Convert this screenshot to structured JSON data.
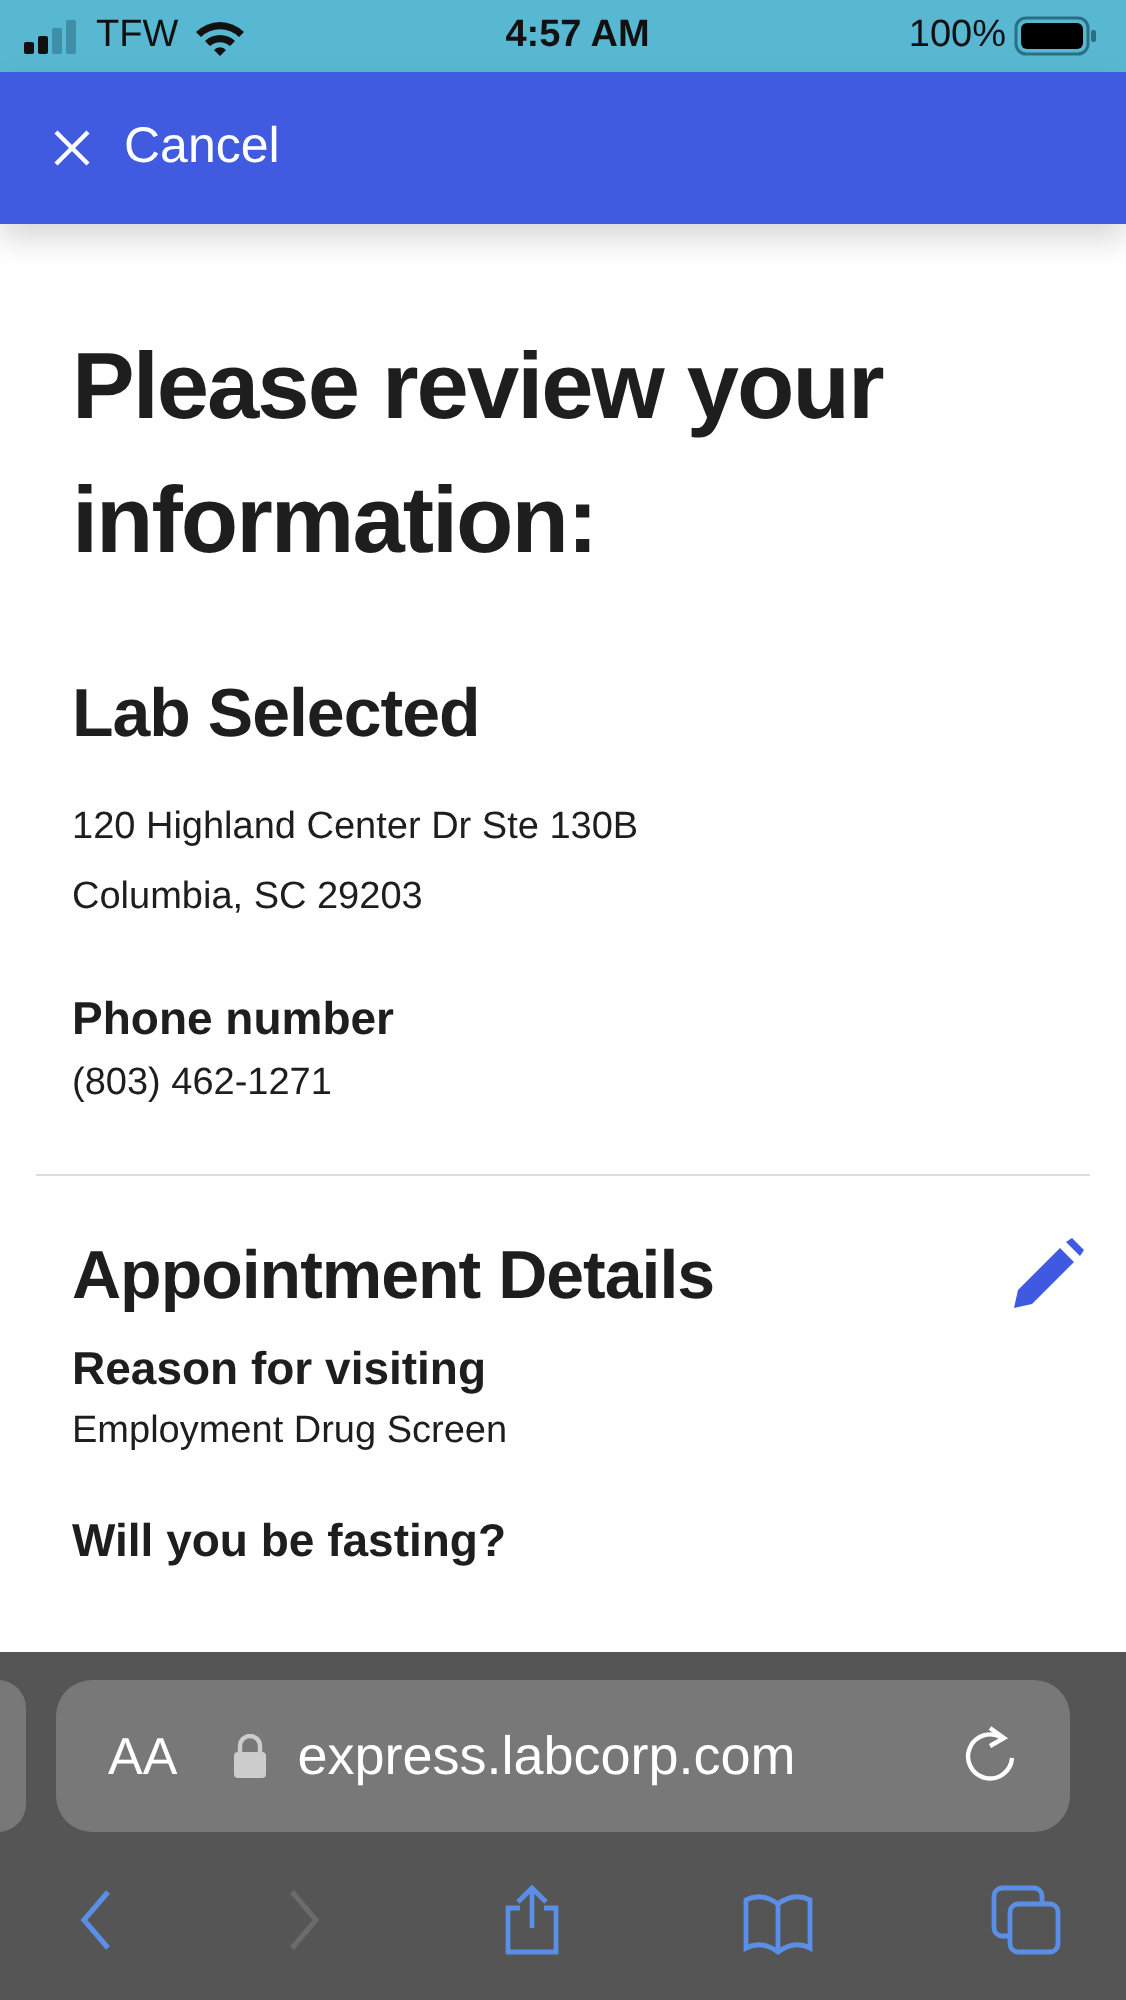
{
  "status_bar": {
    "carrier": "TFW",
    "time": "4:57 AM",
    "battery": "100%"
  },
  "header": {
    "cancel": "Cancel"
  },
  "title": "Please review your information:",
  "lab": {
    "heading": "Lab Selected",
    "address_lines": [
      "120 Highland Center Dr Ste 130B",
      "Columbia, SC 29203"
    ],
    "phone_label": "Phone number",
    "phone": "(803) 462-1271"
  },
  "appointment": {
    "heading": "Appointment Details",
    "fields": [
      {
        "label": "Reason for visiting",
        "value": "Employment Drug Screen"
      },
      {
        "label": "Will you be fasting?"
      }
    ]
  },
  "browser": {
    "text_size": "AA",
    "url": "express.labcorp.com",
    "nav": [
      {
        "kind": "back",
        "disabled": false
      },
      {
        "kind": "forward",
        "disabled": true
      },
      {
        "kind": "share",
        "disabled": false
      },
      {
        "kind": "bookmarks",
        "disabled": false
      },
      {
        "kind": "tabs",
        "disabled": false
      }
    ]
  }
}
